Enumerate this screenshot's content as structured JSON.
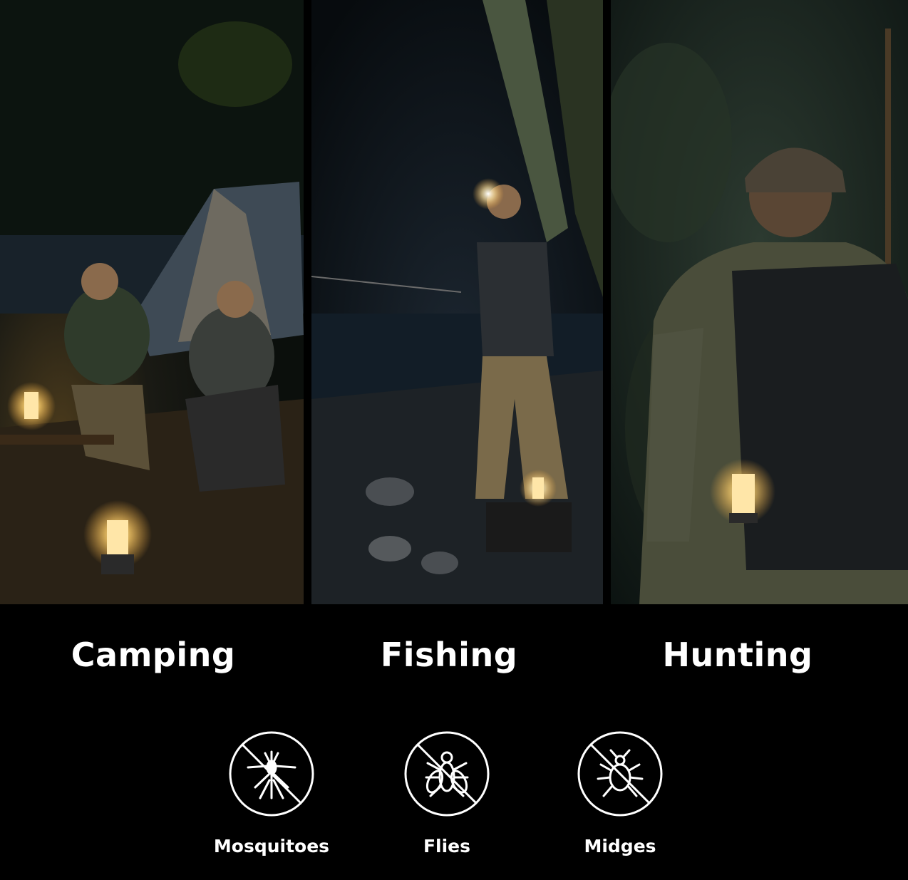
{
  "activities": [
    {
      "label": "Camping",
      "icon": "tent-scene"
    },
    {
      "label": "Fishing",
      "icon": "angler-scene"
    },
    {
      "label": "Hunting",
      "icon": "hunter-scene"
    }
  ],
  "pests": [
    {
      "label": "Mosquitoes",
      "icon": "no-mosquito-icon"
    },
    {
      "label": "Flies",
      "icon": "no-fly-icon"
    },
    {
      "label": "Midges",
      "icon": "no-midge-icon"
    }
  ],
  "colors": {
    "background": "#000000",
    "text": "#ffffff",
    "lantern_glow": "#ffd27a"
  }
}
